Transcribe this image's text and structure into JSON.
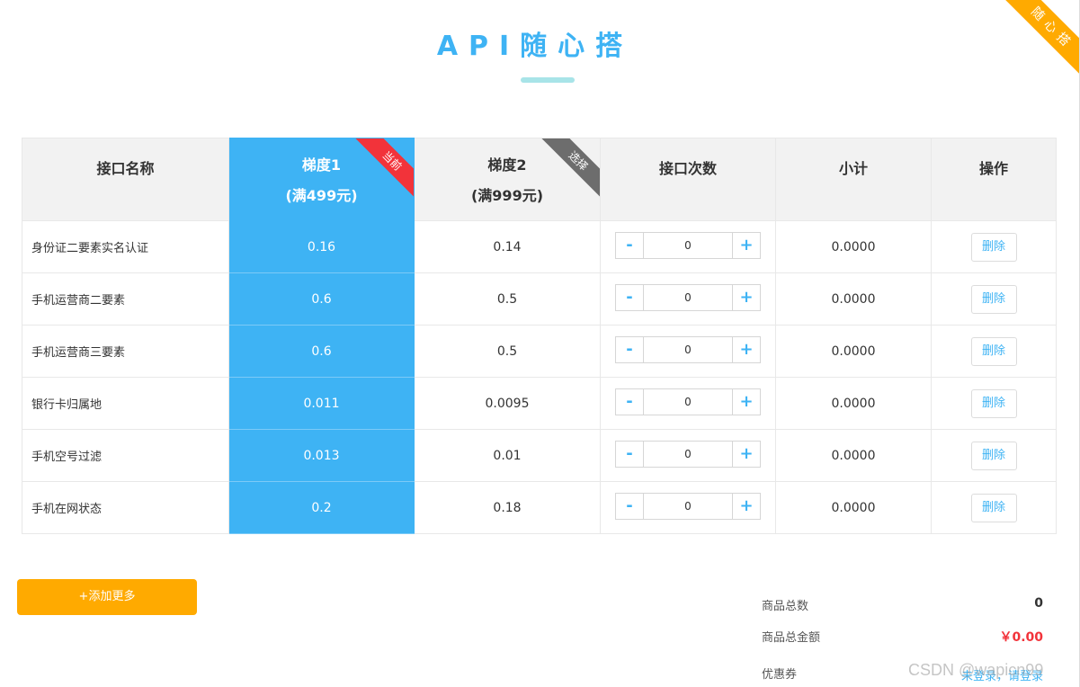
{
  "header": {
    "title": "API随心搭",
    "corner_ribbon": "随心搭"
  },
  "table": {
    "columns": {
      "name": "接口名称",
      "tier1_name": "梯度1",
      "tier1_cond": "(满499元)",
      "tier1_tag": "当前",
      "tier2_name": "梯度2",
      "tier2_cond": "(满999元)",
      "tier2_tag": "选择",
      "count": "接口次数",
      "subtotal": "小计",
      "action": "操作"
    },
    "rows": [
      {
        "name": "身份证二要素实名认证",
        "tier1": "0.16",
        "tier2": "0.14",
        "count": "0",
        "subtotal": "0.0000",
        "action": "删除"
      },
      {
        "name": "手机运营商二要素",
        "tier1": "0.6",
        "tier2": "0.5",
        "count": "0",
        "subtotal": "0.0000",
        "action": "删除"
      },
      {
        "name": "手机运营商三要素",
        "tier1": "0.6",
        "tier2": "0.5",
        "count": "0",
        "subtotal": "0.0000",
        "action": "删除"
      },
      {
        "name": "银行卡归属地",
        "tier1": "0.011",
        "tier2": "0.0095",
        "count": "0",
        "subtotal": "0.0000",
        "action": "删除"
      },
      {
        "name": "手机空号过滤",
        "tier1": "0.013",
        "tier2": "0.01",
        "count": "0",
        "subtotal": "0.0000",
        "action": "删除"
      },
      {
        "name": "手机在网状态",
        "tier1": "0.2",
        "tier2": "0.18",
        "count": "0",
        "subtotal": "0.0000",
        "action": "删除"
      }
    ],
    "stepper_minus": "-",
    "stepper_plus": "+"
  },
  "actions": {
    "add_more": "+添加更多"
  },
  "summary": {
    "total_count_label": "商品总数",
    "total_count_value": "0",
    "total_amount_label": "商品总金额",
    "total_amount_value": "￥0.00",
    "coupon_label": "优惠券",
    "coupon_link": "未登录，请登录"
  },
  "watermark": "CSDN @wapicn99",
  "colors": {
    "accent": "#3eb3f4",
    "orange": "#ffaa00",
    "red": "#f2333a",
    "gray_tag": "#6d6d6d"
  }
}
